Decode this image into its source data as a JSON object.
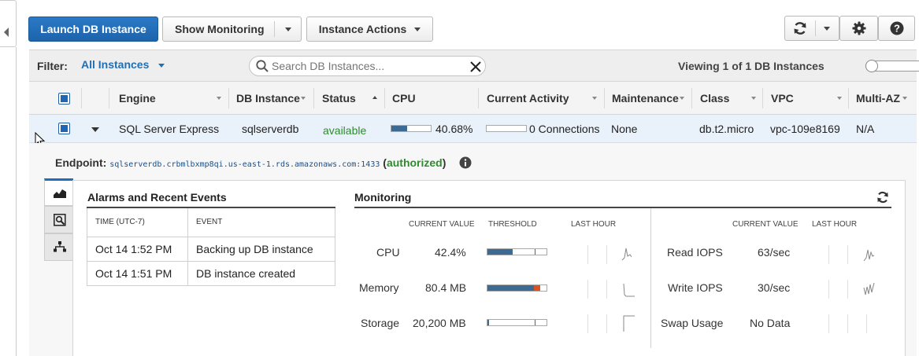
{
  "toolbar": {
    "launch_label": "Launch DB Instance",
    "monitoring_label": "Show Monitoring",
    "actions_label": "Instance Actions"
  },
  "filterbar": {
    "filter_label": "Filter:",
    "filter_value": "All Instances",
    "search_placeholder": "Search DB Instances...",
    "viewing_text": "Viewing 1 of 1 DB Instances"
  },
  "table": {
    "headers": [
      "Engine",
      "DB Instance",
      "Status",
      "CPU",
      "Current Activity",
      "Maintenance",
      "Class",
      "VPC",
      "Multi-AZ"
    ],
    "row": {
      "engine": "SQL Server Express",
      "db_instance": "sqlserverdb",
      "status": "available",
      "cpu_text": "40.68%",
      "cpu_fraction": 0.4068,
      "activity": "0 Connections",
      "maintenance": "None",
      "class": "db.t2.micro",
      "vpc": "vpc-109e8169",
      "multi_az": "N/A"
    }
  },
  "detail": {
    "endpoint_label": "Endpoint:",
    "endpoint_value": "sqlserverdb.crbmlbxmp8qi.us-east-1.rds.amazonaws.com:1433",
    "authorized_open": "(",
    "authorized_text": "authorized",
    "authorized_close": ")"
  },
  "events": {
    "title": "Alarms and Recent Events",
    "time_header": "TIME (UTC-7)",
    "event_header": "EVENT",
    "rows": [
      {
        "time": "Oct 14 1:52 PM",
        "event": "Backing up DB instance"
      },
      {
        "time": "Oct 14 1:51 PM",
        "event": "DB instance created"
      }
    ]
  },
  "monitoring": {
    "title": "Monitoring",
    "col_current": "CURRENT VALUE",
    "col_threshold": "THRESHOLD",
    "col_last_hour": "LAST HOUR",
    "left_metrics": [
      {
        "name": "CPU",
        "value": "42.4%",
        "fill_fraction": 0.42
      },
      {
        "name": "Memory",
        "value": "80.4 MB",
        "fill_fraction": 0.87
      },
      {
        "name": "Storage",
        "value": "20,200 MB",
        "fill_fraction": 0.02
      }
    ],
    "right_metrics": [
      {
        "name": "Read IOPS",
        "value": "63/sec"
      },
      {
        "name": "Write IOPS",
        "value": "30/sec"
      },
      {
        "name": "Swap Usage",
        "value": "No Data"
      }
    ]
  },
  "colors": {
    "primary": "#1d63aa",
    "status_available": "#2e8b2e",
    "bar_fill": "#3d6a93",
    "threshold": "#cc3333",
    "memory_warning": "#d9541e"
  },
  "icons": {
    "refresh": "refresh-icon",
    "settings": "gear-icon",
    "help": "help-icon",
    "search": "search-icon",
    "clear": "close-icon",
    "info": "info-icon"
  }
}
